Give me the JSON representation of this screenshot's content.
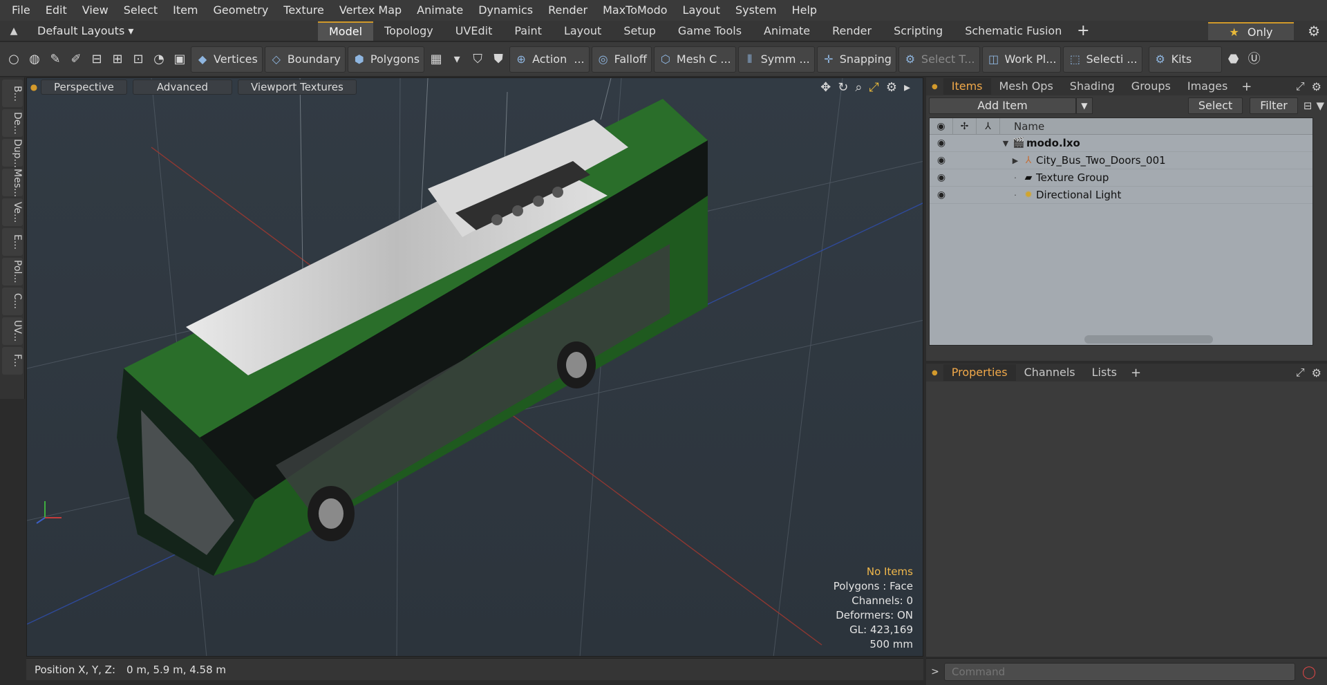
{
  "menu": [
    "File",
    "Edit",
    "View",
    "Select",
    "Item",
    "Geometry",
    "Texture",
    "Vertex Map",
    "Animate",
    "Dynamics",
    "Render",
    "MaxToModo",
    "Layout",
    "System",
    "Help"
  ],
  "layout": {
    "selector": "Default Layouts ▾",
    "tabs": [
      "Model",
      "Topology",
      "UVEdit",
      "Paint",
      "Layout",
      "Setup",
      "Game Tools",
      "Animate",
      "Render",
      "Scripting",
      "Schematic Fusion"
    ],
    "active_tab": "Model",
    "only_label": "Only"
  },
  "toolbar": {
    "vertices": "Vertices",
    "boundary": "Boundary",
    "polygons": "Polygons",
    "action": "Action",
    "action_more": "...",
    "falloff": "Falloff",
    "mesh": "Mesh C ...",
    "symmetry": "Symm ...",
    "snapping": "Snapping",
    "select_t": "Select T...",
    "work_plane": "Work Pl...",
    "selection": "Selecti ...",
    "kits": "Kits"
  },
  "left_strip": [
    "B...",
    "De...",
    "Dup...",
    "Mes...",
    "Ve...",
    "E...",
    "Pol...",
    "C...",
    "UV...",
    "F..."
  ],
  "viewport": {
    "view_mode": "Perspective",
    "shading": "Advanced",
    "textures": "Viewport Textures",
    "stats": {
      "selection": "No Items",
      "polygons": "Polygons : Face",
      "channels": "Channels: 0",
      "deformers": "Deformers: ON",
      "gl": "GL: 423,169",
      "grid": "500 mm"
    }
  },
  "status": {
    "label": "Position X, Y, Z:",
    "value": "0 m, 5.9 m, 4.58 m"
  },
  "items_panel": {
    "tabs": [
      "Items",
      "Mesh Ops",
      "Shading",
      "Groups",
      "Images"
    ],
    "active_tab": "Items",
    "add_item": "Add Item",
    "select": "Select",
    "filter": "Filter",
    "column_name": "Name",
    "tree": [
      {
        "label": "modo.lxo",
        "bold": true
      },
      {
        "label": "City_Bus_Two_Doors_001",
        "bold": false
      },
      {
        "label": "Texture Group",
        "bold": false
      },
      {
        "label": "Directional Light",
        "bold": false
      }
    ]
  },
  "properties_panel": {
    "tabs": [
      "Properties",
      "Channels",
      "Lists"
    ],
    "active_tab": "Properties"
  },
  "command": {
    "placeholder": "Command"
  },
  "colors": {
    "accent": "#d19a2a",
    "active_tab_text": "#f1a94a",
    "viewport_bg": "#2f3740",
    "bus_body": "#1f5a1f"
  }
}
